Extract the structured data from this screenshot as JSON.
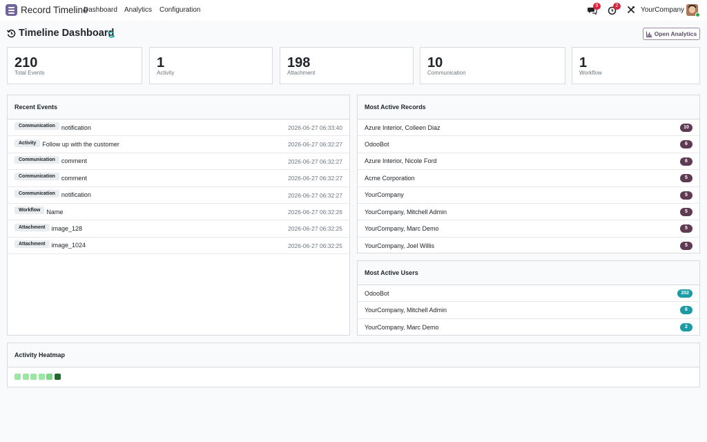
{
  "navbar": {
    "app_name": "Record Timeline",
    "menu": [
      "Dashboard",
      "Analytics",
      "Configuration"
    ],
    "messages_count": "9",
    "activities_count": "2",
    "company": "YourCompany"
  },
  "header": {
    "title": "Timeline Dashboard",
    "open_analytics_label": "Open Analytics"
  },
  "stats": [
    {
      "value": "210",
      "label": "Total Events"
    },
    {
      "value": "1",
      "label": "Activity"
    },
    {
      "value": "198",
      "label": "Attachment"
    },
    {
      "value": "10",
      "label": "Communication"
    },
    {
      "value": "1",
      "label": "Workflow"
    }
  ],
  "recent_events": {
    "title": "Recent Events",
    "rows": [
      {
        "type": "Communication",
        "name": "notification",
        "time": "2026-06-27 06:33:40"
      },
      {
        "type": "Activity",
        "name": "Follow up with the customer",
        "time": "2026-06-27 06:32:27"
      },
      {
        "type": "Communication",
        "name": "comment",
        "time": "2026-06-27 06:32:27"
      },
      {
        "type": "Communication",
        "name": "comment",
        "time": "2026-06-27 06:32:27"
      },
      {
        "type": "Communication",
        "name": "notification",
        "time": "2026-06-27 06:32:27"
      },
      {
        "type": "Workflow",
        "name": "Name",
        "time": "2026-06-27 06:32:26"
      },
      {
        "type": "Attachment",
        "name": "image_128",
        "time": "2026-06-27 06:32:25"
      },
      {
        "type": "Attachment",
        "name": "image_1024",
        "time": "2026-06-27 06:32:25"
      }
    ]
  },
  "most_active_records": {
    "title": "Most Active Records",
    "rows": [
      {
        "name": "Azure Interior, Colleen Diaz",
        "count": "10"
      },
      {
        "name": "OdooBot",
        "count": "6"
      },
      {
        "name": "Azure Interior, Nicole Ford",
        "count": "6"
      },
      {
        "name": "Acme Corporation",
        "count": "5"
      },
      {
        "name": "YourCompany",
        "count": "5"
      },
      {
        "name": "YourCompany, Mitchell Admin",
        "count": "5"
      },
      {
        "name": "YourCompany, Marc Demo",
        "count": "5"
      },
      {
        "name": "YourCompany, Joel Willis",
        "count": "5"
      }
    ]
  },
  "most_active_users": {
    "title": "Most Active Users",
    "rows": [
      {
        "name": "OdooBot",
        "count": "202"
      },
      {
        "name": "YourCompany, Mitchell Admin",
        "count": "6"
      },
      {
        "name": "YourCompany, Marc Demo",
        "count": "2"
      }
    ]
  },
  "heatmap": {
    "title": "Activity Heatmap",
    "cells": [
      "#9be6a3",
      "#9be6a3",
      "#9be6a3",
      "#9be6a3",
      "#7fd98a",
      "#1e6b2e"
    ]
  },
  "colors": {
    "brand": "#71639e",
    "record_pill": "#5f3a53",
    "user_pill": "#1a9ba6",
    "badge": "#d7263d"
  }
}
